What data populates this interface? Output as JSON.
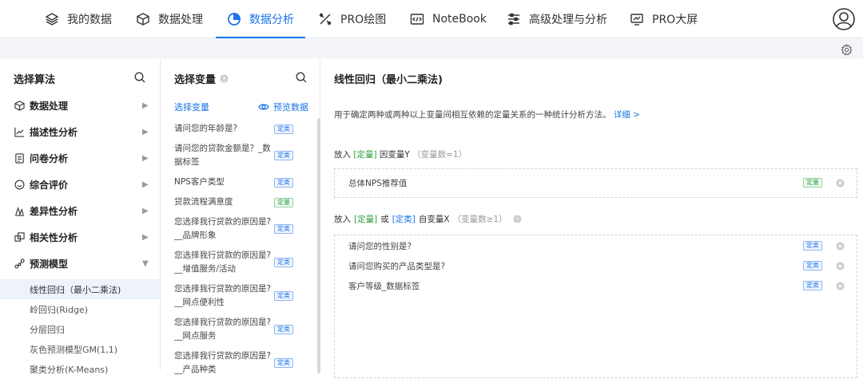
{
  "nav": {
    "items": [
      {
        "label": "我的数据",
        "icon": "layers-icon"
      },
      {
        "label": "数据处理",
        "icon": "cube-icon"
      },
      {
        "label": "数据分析",
        "icon": "pie-chart-icon",
        "active": true
      },
      {
        "label": "PRO绘图",
        "icon": "pro-draw-icon"
      },
      {
        "label": "NoteBook",
        "icon": "code-icon"
      },
      {
        "label": "高级处理与分析",
        "icon": "sliders-icon"
      },
      {
        "label": "PRO大屏",
        "icon": "screen-chart-icon"
      }
    ],
    "accent": "#1a73e8"
  },
  "algorithms": {
    "title": "选择算法",
    "groups": [
      {
        "label": "数据处理",
        "icon": "cube-icon"
      },
      {
        "label": "描述性分析",
        "icon": "line-chart-icon"
      },
      {
        "label": "问卷分析",
        "icon": "survey-icon"
      },
      {
        "label": "综合评价",
        "icon": "chat-icon"
      },
      {
        "label": "差异性分析",
        "icon": "diff-icon"
      },
      {
        "label": "相关性分析",
        "icon": "correlation-icon"
      },
      {
        "label": "预测模型",
        "icon": "model-icon",
        "expanded": true
      }
    ],
    "sub_items": [
      {
        "label": "线性回归（最小二乘法)",
        "selected": true
      },
      {
        "label": "岭回归(Ridge)"
      },
      {
        "label": "分层回归"
      },
      {
        "label": "灰色预测模型GM(1,1)"
      },
      {
        "label": "聚类分析(K-Means)"
      }
    ]
  },
  "variables": {
    "title": "选择变量",
    "tab_label": "选择变量",
    "preview_label": "预览数据",
    "items": [
      {
        "lines": [
          "请问您的年龄是?"
        ],
        "tag": "定类",
        "tag_color": "blue"
      },
      {
        "lines": [
          "请问您的贷款金额是？_数",
          "据标签"
        ],
        "tag": "定类",
        "tag_color": "blue"
      },
      {
        "lines": [
          "NPS客户类型"
        ],
        "tag": "定类",
        "tag_color": "blue"
      },
      {
        "lines": [
          "贷款流程满意度"
        ],
        "tag": "定量",
        "tag_color": "green"
      },
      {
        "lines": [
          "您选择我行贷款的原因是?",
          "__品牌形象"
        ],
        "tag": "定类",
        "tag_color": "blue"
      },
      {
        "lines": [
          "您选择我行贷款的原因是?",
          "__增值服务/活动"
        ],
        "tag": "定类",
        "tag_color": "blue"
      },
      {
        "lines": [
          "您选择我行贷款的原因是?",
          "__网点便利性"
        ],
        "tag": "定类",
        "tag_color": "blue"
      },
      {
        "lines": [
          "您选择我行贷款的原因是?",
          "__网点服务"
        ],
        "tag": "定类",
        "tag_color": "blue"
      },
      {
        "lines": [
          "您选择我行贷款的原因是?",
          "__产品种类"
        ],
        "tag": "定类",
        "tag_color": "blue"
      }
    ]
  },
  "method": {
    "title": "线性回归（最小二乘法)",
    "description": "用于确定两种或两种以上变量间相互依赖的定量关系的一种统计分析方法。",
    "detail_link": "详细 >",
    "y_section": {
      "prefix": "放入",
      "type_tag": "[定量]",
      "label": "因变量Y",
      "count": "（变量数=1）"
    },
    "y_items": [
      {
        "label": "总体NPS推荐值",
        "tag": "定量",
        "tag_color": "green"
      }
    ],
    "x_section": {
      "prefix": "放入",
      "type_tag1": "[定量]",
      "or": "或",
      "type_tag2": "[定类]",
      "label": "自变量X",
      "count": "（变量数≥1）"
    },
    "x_items": [
      {
        "label": "请问您的性别是?",
        "tag": "定类",
        "tag_color": "blue"
      },
      {
        "label": "请问您购买的产品类型是?",
        "tag": "定类",
        "tag_color": "blue"
      },
      {
        "label": "客户等级_数据标签",
        "tag": "定类",
        "tag_color": "blue"
      }
    ]
  }
}
